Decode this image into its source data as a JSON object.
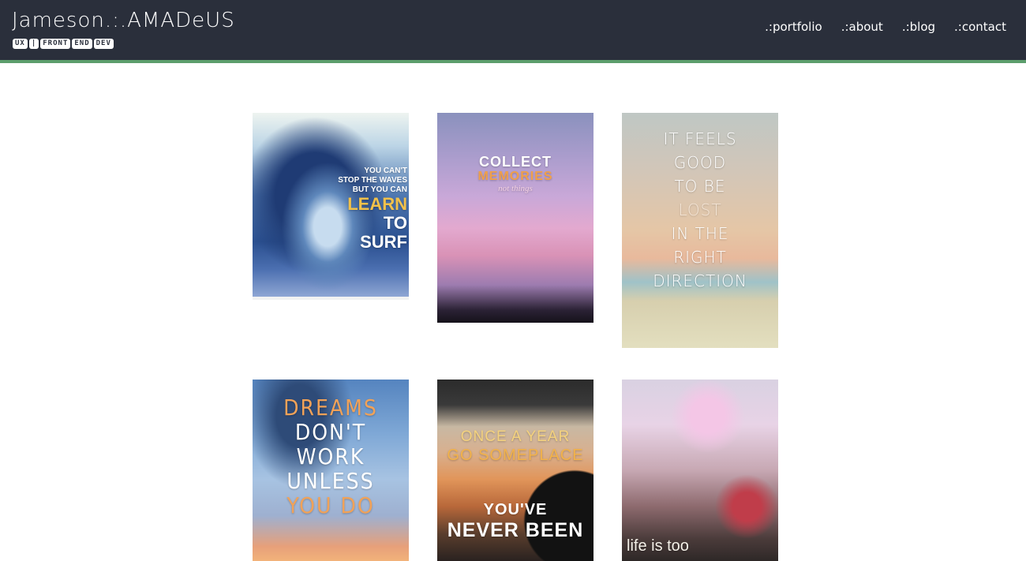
{
  "header": {
    "brand_title": "Jameson.:.AMADeUS",
    "brand_subtitle_chips": [
      "UX",
      "|",
      "FRONT",
      "END",
      "DEV"
    ],
    "nav": [
      ".:portfolio",
      ".:about",
      ".:blog",
      ".:contact"
    ],
    "accent_color": "#5c9e6c",
    "background_color": "#2a2f3b"
  },
  "gallery": {
    "tiles": [
      {
        "lines": [
          "YOU CAN'T",
          "STOP THE WAVES",
          "BUT YOU CAN",
          "LEARN",
          "TO",
          "SURF"
        ]
      },
      {
        "lines": [
          "COLLECT",
          "MEMORIES",
          "not things"
        ]
      },
      {
        "lines": [
          "IT FEELS",
          "GOOD",
          "TO BE",
          "LOST",
          "IN THE",
          "RIGHT",
          "DIRECTION"
        ]
      },
      {
        "lines": [
          "DREAMS",
          "DON'T",
          "WORK",
          "UNLESS",
          "YOU DO"
        ]
      },
      {
        "lines": [
          "ONCE A YEAR",
          "GO SOMEPLACE",
          "YOU'VE",
          "NEVER BEEN"
        ]
      },
      {
        "lines": [
          "life is too"
        ]
      }
    ]
  }
}
